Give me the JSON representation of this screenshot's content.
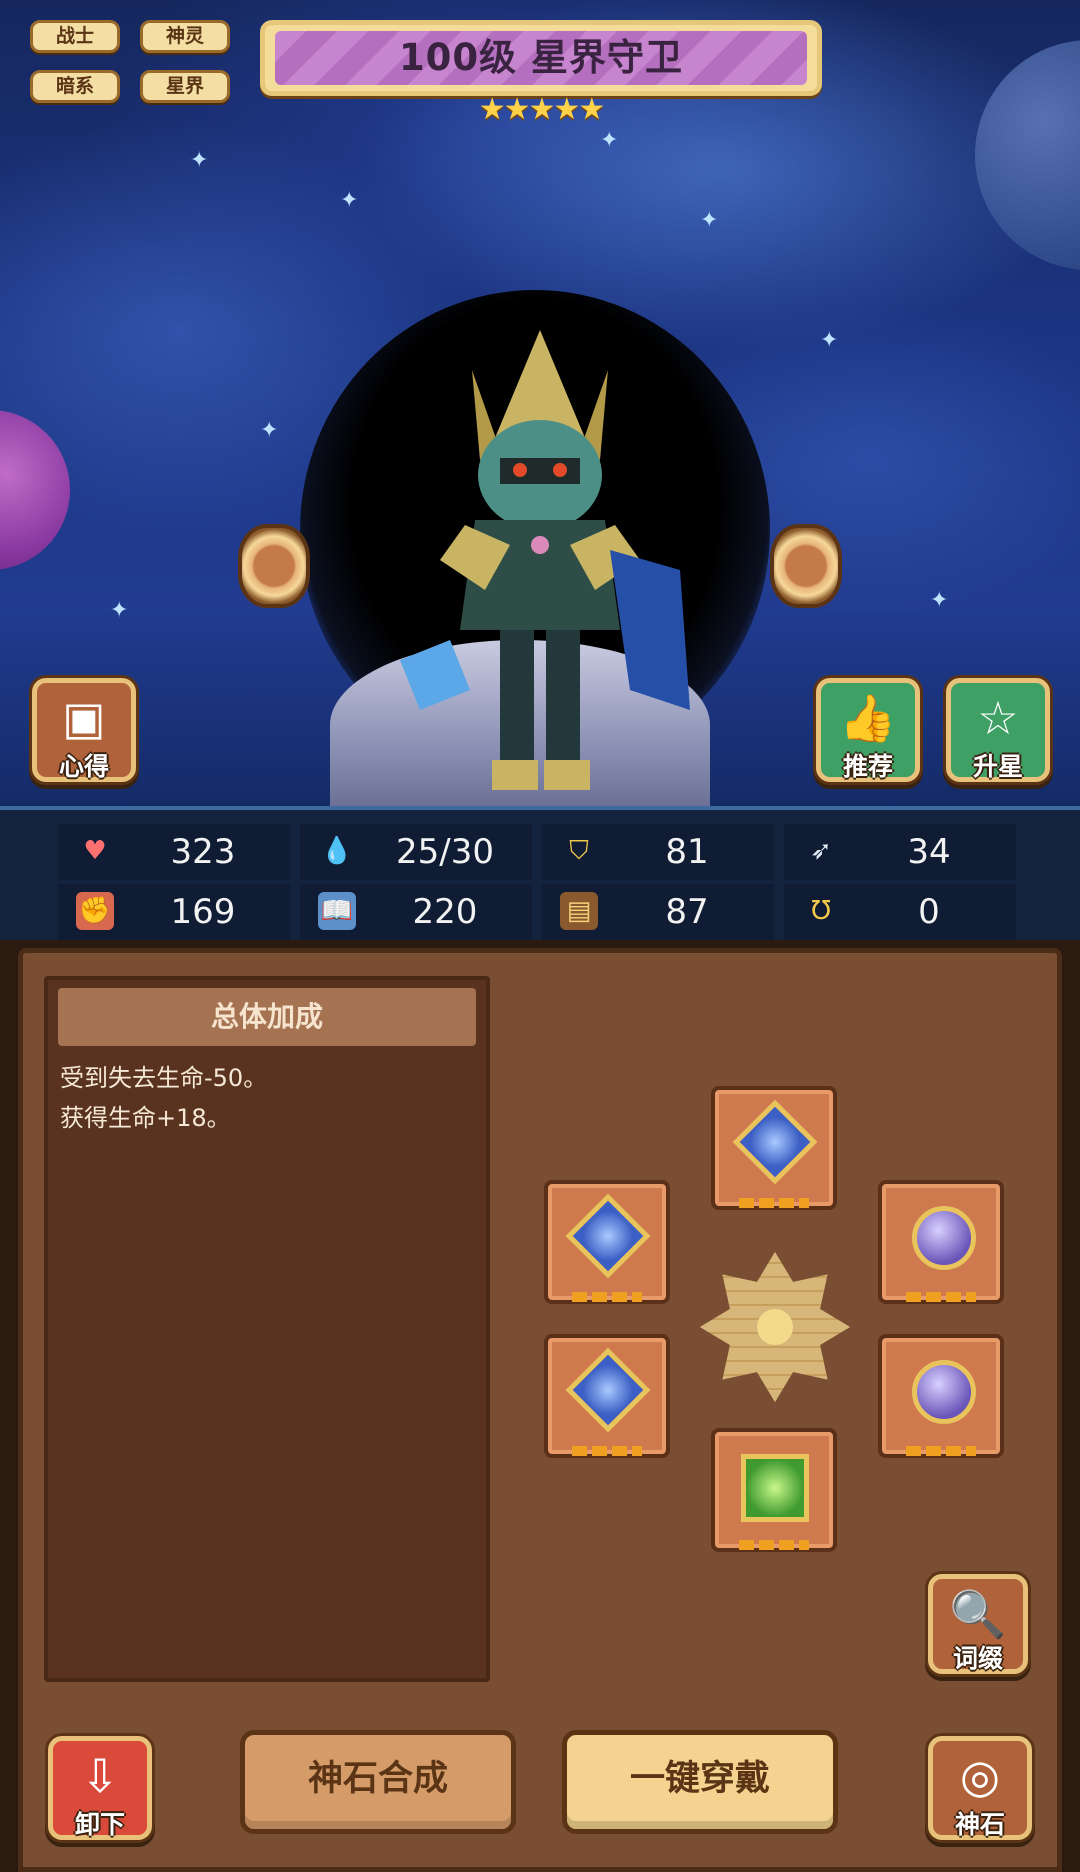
{
  "tags": [
    "战士",
    "神灵",
    "暗系",
    "星界"
  ],
  "hero": {
    "title": "100级 星界守卫",
    "stars": "★★★★★"
  },
  "side_buttons": {
    "insight": "心得",
    "recommend": "推荐",
    "star_up": "升星"
  },
  "stats": [
    {
      "icon": "heart-icon",
      "value": "323"
    },
    {
      "icon": "mana-drop-icon",
      "value": "25/30"
    },
    {
      "icon": "shield-icon",
      "value": "81"
    },
    {
      "icon": "wing-icon",
      "value": "34"
    },
    {
      "icon": "fist-icon",
      "value": "169"
    },
    {
      "icon": "book-icon",
      "value": "220"
    },
    {
      "icon": "scroll-icon",
      "value": "87"
    },
    {
      "icon": "horseshoe-icon",
      "value": "0"
    }
  ],
  "bonus": {
    "title": "总体加成",
    "lines": [
      "受到失去生命-50。",
      "获得生命+18。"
    ]
  },
  "affix_label": "词缀",
  "bottom": {
    "unequip": "卸下",
    "synth": "神石合成",
    "equip_all": "一键穿戴",
    "godstone": "神石"
  },
  "colors": {
    "panel": "#7a4e33",
    "banner": "#c785cf",
    "green_button": "#3ea064",
    "red_button": "#d94a3a"
  }
}
